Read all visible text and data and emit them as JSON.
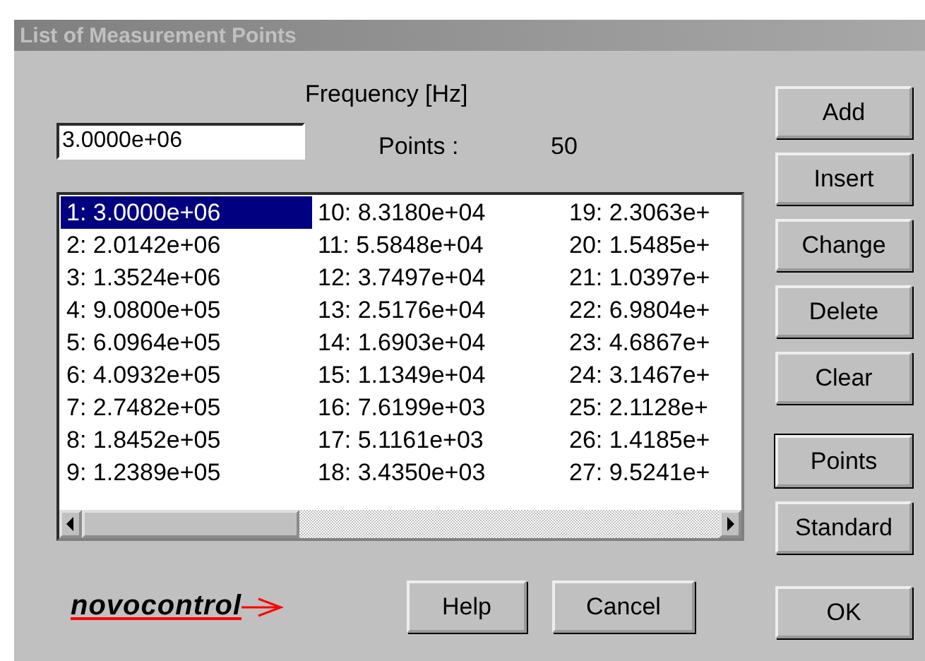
{
  "window": {
    "title": "List of Measurement Points",
    "active": false
  },
  "frequency": {
    "label": "Frequency [Hz]",
    "value": "3.0000e+06"
  },
  "points": {
    "label": "Points :",
    "value": "50"
  },
  "list": {
    "items": [
      {
        "text": "1: 3.0000e+06",
        "selected": true
      },
      {
        "text": "2: 2.0142e+06",
        "selected": false
      },
      {
        "text": "3: 1.3524e+06",
        "selected": false
      },
      {
        "text": "4: 9.0800e+05",
        "selected": false
      },
      {
        "text": "5: 6.0964e+05",
        "selected": false
      },
      {
        "text": "6: 4.0932e+05",
        "selected": false
      },
      {
        "text": "7: 2.7482e+05",
        "selected": false
      },
      {
        "text": "8: 1.8452e+05",
        "selected": false
      },
      {
        "text": "9: 1.2389e+05",
        "selected": false
      },
      {
        "text": "10: 8.3180e+04",
        "selected": false
      },
      {
        "text": "11: 5.5848e+04",
        "selected": false
      },
      {
        "text": "12: 3.7497e+04",
        "selected": false
      },
      {
        "text": "13: 2.5176e+04",
        "selected": false
      },
      {
        "text": "14: 1.6903e+04",
        "selected": false
      },
      {
        "text": "15: 1.1349e+04",
        "selected": false
      },
      {
        "text": "16: 7.6199e+03",
        "selected": false
      },
      {
        "text": "17: 5.1161e+03",
        "selected": false
      },
      {
        "text": "18: 3.4350e+03",
        "selected": false
      },
      {
        "text": "19: 2.3063e+",
        "selected": false
      },
      {
        "text": "20: 1.5485e+",
        "selected": false
      },
      {
        "text": "21: 1.0397e+",
        "selected": false
      },
      {
        "text": "22: 6.9804e+",
        "selected": false
      },
      {
        "text": "23: 4.6867e+",
        "selected": false
      },
      {
        "text": "24: 3.1467e+",
        "selected": false
      },
      {
        "text": "25: 2.1128e+",
        "selected": false
      },
      {
        "text": "26: 1.4185e+",
        "selected": false
      },
      {
        "text": "27: 9.5241e+",
        "selected": false
      }
    ]
  },
  "side_buttons": [
    {
      "label": "Add",
      "default": false
    },
    {
      "label": "Insert",
      "default": false
    },
    {
      "label": "Change",
      "default": false
    },
    {
      "label": "Delete",
      "default": false
    },
    {
      "label": "Clear",
      "default": false
    },
    {
      "label": "Points",
      "default": true
    },
    {
      "label": "Standard",
      "default": false
    }
  ],
  "logo": "novocontrol",
  "bottom_buttons": [
    {
      "label": "Help"
    },
    {
      "label": "Cancel"
    },
    {
      "label": "OK"
    }
  ]
}
